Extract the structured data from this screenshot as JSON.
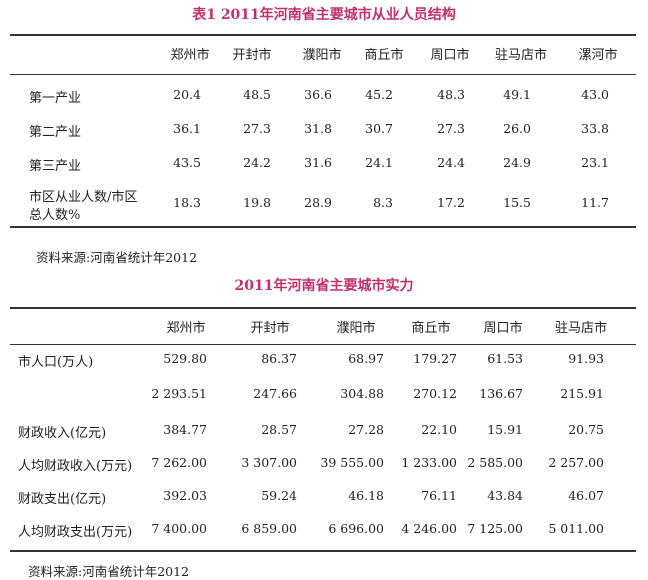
{
  "table1": {
    "title": "表1  2011年河南省主要城市从业人员结构",
    "columns": [
      "郑州市",
      "开封市",
      "濮阳市",
      "商丘市",
      "周口市",
      "驻马店市",
      "漯河市"
    ],
    "rows": [
      {
        "label": [
          "第一产业"
        ],
        "values": [
          "20.4",
          "48.5",
          "36.6",
          "45.2",
          "48.3",
          "49.1",
          "43.0"
        ]
      },
      {
        "label": [
          "第二产业"
        ],
        "values": [
          "36.1",
          "27.3",
          "31.8",
          "30.7",
          "27.3",
          "26.0",
          "33.8"
        ]
      },
      {
        "label": [
          "第三产业"
        ],
        "values": [
          "43.5",
          "24.2",
          "31.6",
          "24.1",
          "24.4",
          "24.9",
          "23.1"
        ]
      },
      {
        "label": [
          "市区从业人数/市区",
          "总人数%"
        ],
        "values": [
          "18.3",
          "19.8",
          "28.9",
          "8.3",
          "17.2",
          "15.5",
          "11.7"
        ]
      }
    ],
    "source": "资料来源:河南省统计年2012"
  },
  "table2": {
    "title": "2011年河南省主要城市实力",
    "columns": [
      "郑州市",
      "开封市",
      "濮阳市",
      "商丘市",
      "周口市",
      "驻马店市"
    ],
    "rows": [
      {
        "label": "市人口(万人)",
        "values": [
          "529.80",
          "86.37",
          "68.97",
          "179.27",
          "61.53",
          "91.93"
        ]
      },
      {
        "label": "",
        "values": [
          "2 293.51",
          "247.66",
          "304.88",
          "270.12",
          "136.67",
          "215.91"
        ]
      },
      {
        "label": "财政收入(亿元)",
        "values": [
          "384.77",
          "28.57",
          "27.28",
          "22.10",
          "15.91",
          "20.75"
        ]
      },
      {
        "label": "人均财政收入(万元)",
        "values": [
          "7 262.00",
          "3 307.00",
          "39 555.00",
          "1 233.00",
          "2 585.00",
          "2 257.00"
        ]
      },
      {
        "label": "财政支出(亿元)",
        "values": [
          "392.03",
          "59.24",
          "46.18",
          "76.11",
          "43.84",
          "46.07"
        ]
      },
      {
        "label": "人均财政支出(万元)",
        "values": [
          "7 400.00",
          "6 859.00",
          "6 696.00",
          "4 246.00",
          "7 125.00",
          "5 011.00"
        ]
      }
    ],
    "source": "资料来源:河南省统计年2012"
  }
}
